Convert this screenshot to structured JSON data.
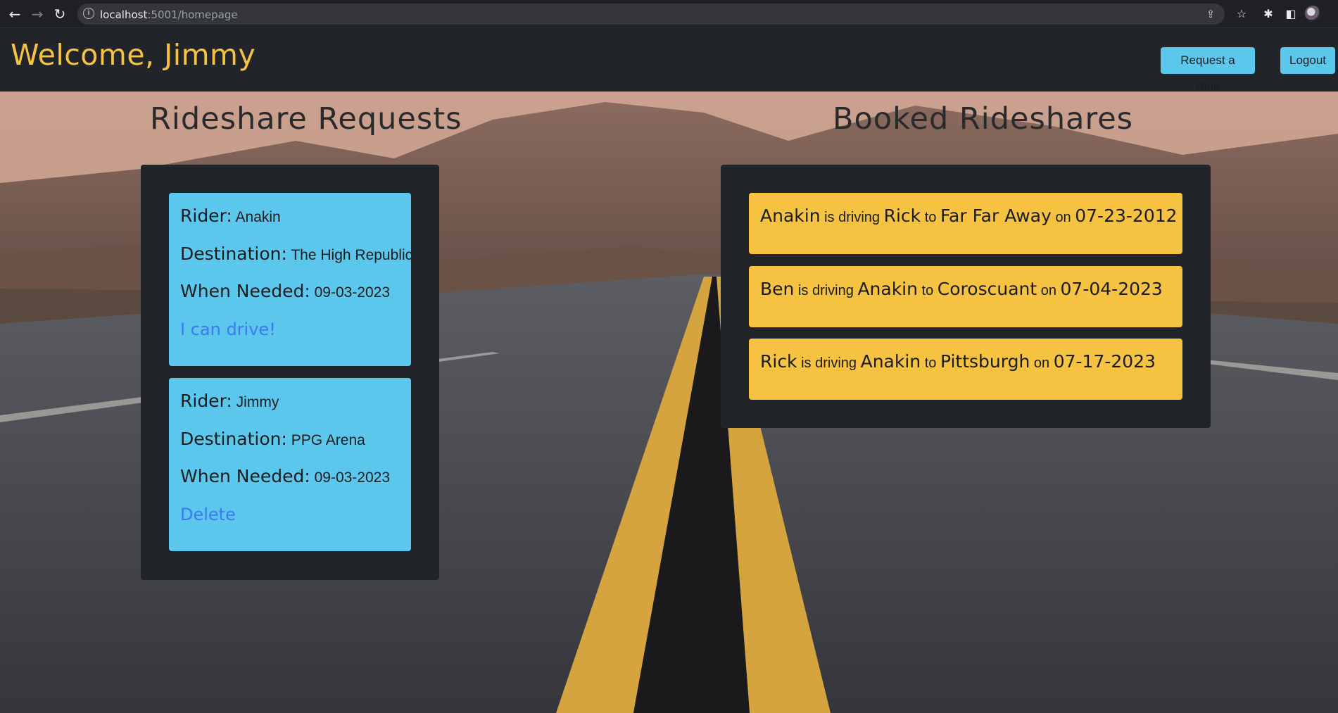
{
  "browser": {
    "url_host": "localhost",
    "url_path": ":5001/homepage"
  },
  "header": {
    "welcome": "Welcome, Jimmy",
    "request_ride_label": "Request a Ride",
    "logout_label": "Logout"
  },
  "requests": {
    "title": "Rideshare Requests",
    "rider_label": "Rider:",
    "destination_label": "Destination:",
    "when_label": "When Needed:",
    "items": [
      {
        "rider": "Anakin",
        "destination": "The High Republic",
        "when": "09-03-2023",
        "action": "I can drive!"
      },
      {
        "rider": "Jimmy",
        "destination": "PPG Arena",
        "when": "09-03-2023",
        "action": "Delete"
      }
    ]
  },
  "booked": {
    "title": "Booked Rideshares",
    "word_driving": "is driving",
    "word_to": "to",
    "word_on": "on",
    "items": [
      {
        "driver": "Anakin",
        "rider": "Rick",
        "destination": "Far Far Away",
        "date": "07-23-2012"
      },
      {
        "driver": "Ben",
        "rider": "Anakin",
        "destination": "Coroscuant",
        "date": "07-04-2023"
      },
      {
        "driver": "Rick",
        "rider": "Anakin",
        "destination": "Pittsburgh",
        "date": "07-17-2023"
      }
    ]
  },
  "colors": {
    "accent_yellow": "#f5c242",
    "accent_blue": "#5bc7ec",
    "panel_dark": "#212529",
    "link_blue": "#3d7af0"
  }
}
